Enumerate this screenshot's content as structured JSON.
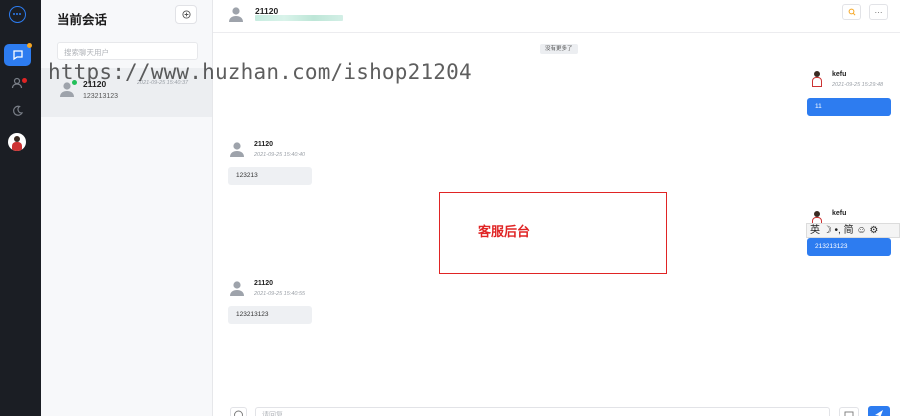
{
  "sidebar_panel": {
    "title": "当前会话",
    "search_placeholder": "搜索聊天用户",
    "conversations": [
      {
        "name": "21120",
        "time": "2021-09-25 15:40:37",
        "preview": "123213123"
      }
    ]
  },
  "chat": {
    "header_name": "21120",
    "no_more": "没有更多了",
    "messages": [
      {
        "direction": "out",
        "name": "kefu",
        "time": "2021-09-25 15:29:48",
        "text": "11"
      },
      {
        "direction": "in",
        "name": "21120",
        "time": "2021-09-25 15:40:40",
        "text": "123213"
      },
      {
        "direction": "out",
        "name": "kefu",
        "time": "",
        "text": "213213123"
      },
      {
        "direction": "in",
        "name": "21120",
        "time": "2021-09-25 15:40:55",
        "text": "123213123"
      }
    ],
    "input_placeholder": "请回复..."
  },
  "overlay": {
    "label": "客服后台",
    "watermark": "https://www.huzhan.com/ishop21204",
    "ime_text": "英 ☽ •, 简 ☺ ⚙"
  },
  "colors": {
    "accent": "#2d7cf0",
    "rail_bg": "#1b1e24",
    "annotation_red": "#e02424",
    "online": "#23c05a"
  }
}
